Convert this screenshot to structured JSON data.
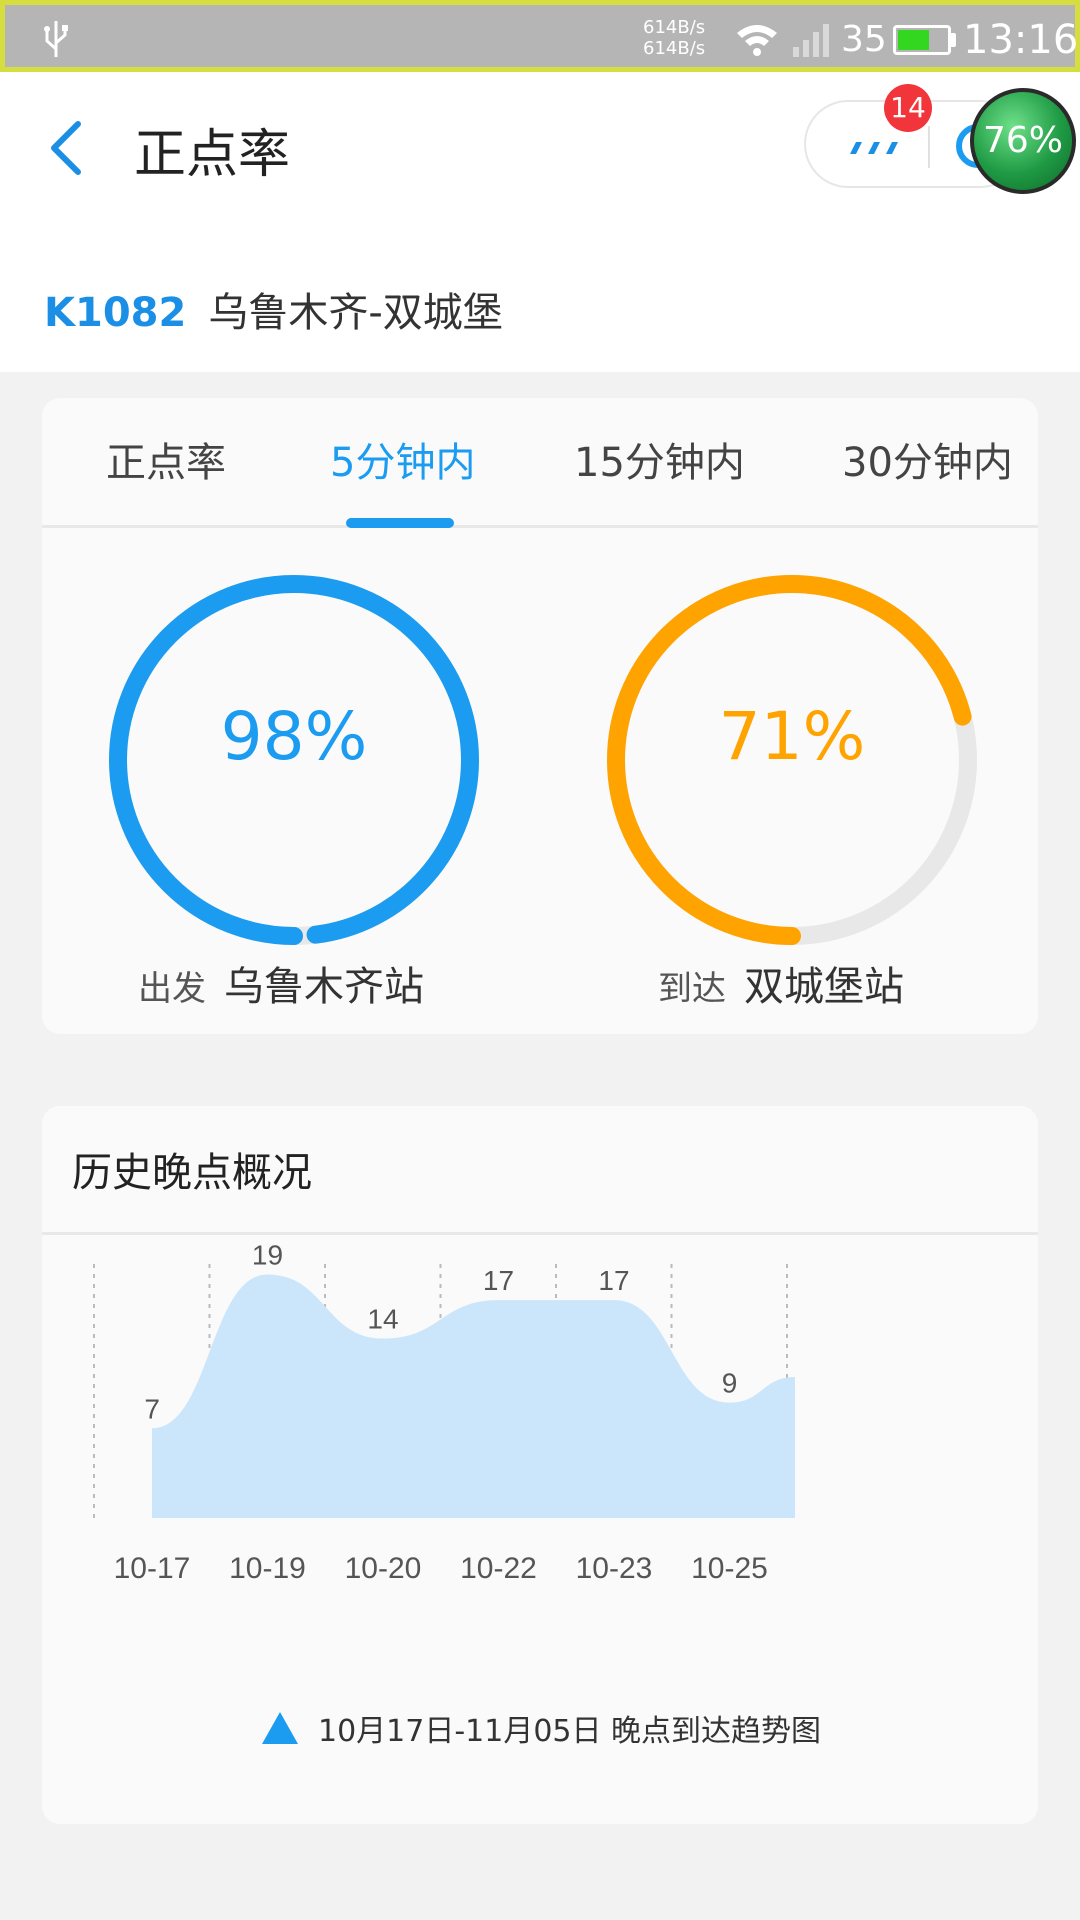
{
  "status_bar": {
    "net_up": "614B/s",
    "net_down": "614B/s",
    "signal_text": "35",
    "battery_level": 0.6,
    "time": "13:16"
  },
  "header": {
    "title": "正点率",
    "notification_count": "14",
    "float_ball": "76%"
  },
  "train": {
    "number": "K1082",
    "route": "乌鲁木齐-双城堡"
  },
  "tabs": [
    "正点率",
    "5分钟内",
    "15分钟内",
    "30分钟内"
  ],
  "active_tab": 1,
  "rings": {
    "departure": {
      "percent_text": "98%",
      "value": 0.98,
      "tag": "出发",
      "station": "乌鲁木齐站",
      "color": "#1b9cf0"
    },
    "arrival": {
      "percent_text": "71%",
      "value": 0.71,
      "tag": "到达",
      "station": "双城堡站",
      "color": "#ffa300"
    }
  },
  "history": {
    "title": "历史晚点概况",
    "legend": "10月17日-11月05日 晚点到达趋势图"
  },
  "chart_data": {
    "type": "area",
    "categories": [
      "10-17",
      "10-19",
      "10-20",
      "10-22",
      "10-23",
      "10-25"
    ],
    "values": [
      7,
      19,
      14,
      17,
      17,
      9
    ],
    "trailing_value": 11,
    "ylim": [
      0,
      22
    ],
    "fill_color": "#cbe6fb",
    "grid": "vertical-dashed"
  }
}
